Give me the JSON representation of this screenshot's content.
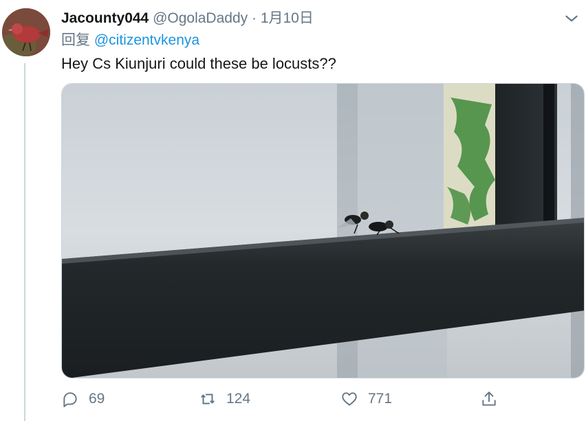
{
  "tweet": {
    "display_name": "Jacounty044",
    "handle": "@OgolaDaddy",
    "separator": "·",
    "date": "1月10日",
    "reply_prefix": "回复",
    "reply_to": "@citizentvkenya",
    "text": "Hey Cs Kiunjuri could these be locusts??"
  },
  "actions": {
    "reply_count": "69",
    "retweet_count": "124",
    "like_count": "771"
  },
  "colors": {
    "text": "#14171a",
    "secondary": "#657786",
    "link": "#1b95e0",
    "border": "#ccd6dd"
  },
  "icons": {
    "more": "chevron-down-icon",
    "reply": "reply-icon",
    "retweet": "retweet-icon",
    "like": "heart-icon",
    "share": "share-icon"
  }
}
